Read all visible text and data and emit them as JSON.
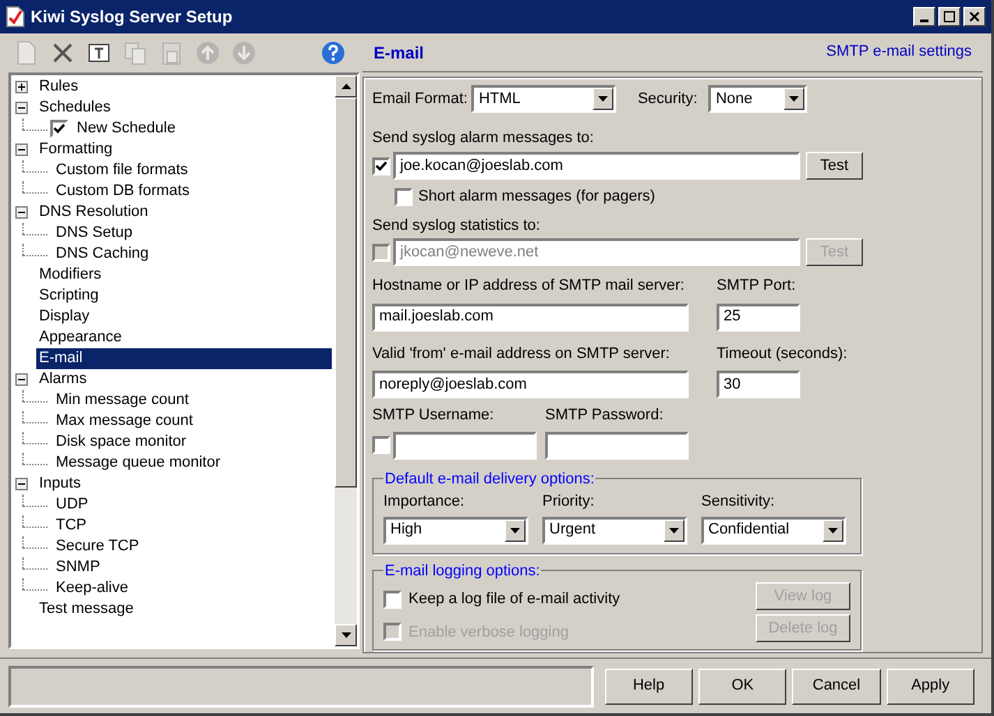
{
  "window": {
    "title": "Kiwi Syslog Server Setup"
  },
  "tree": {
    "items": [
      {
        "label": "Rules",
        "expanded": false,
        "selected": false
      },
      {
        "label": "Schedules",
        "expanded": true,
        "selected": false,
        "children": [
          {
            "label": "New Schedule",
            "checked": true,
            "selected": false
          }
        ]
      },
      {
        "label": "Formatting",
        "expanded": true,
        "selected": false,
        "children": [
          {
            "label": "Custom file formats",
            "selected": false
          },
          {
            "label": "Custom DB formats",
            "selected": false
          }
        ]
      },
      {
        "label": "DNS Resolution",
        "expanded": true,
        "selected": false,
        "children": [
          {
            "label": "DNS Setup",
            "selected": false
          },
          {
            "label": "DNS Caching",
            "selected": false
          }
        ]
      },
      {
        "label": "Modifiers",
        "selected": false
      },
      {
        "label": "Scripting",
        "selected": false
      },
      {
        "label": "Display",
        "selected": false
      },
      {
        "label": "Appearance",
        "selected": false
      },
      {
        "label": "E-mail",
        "selected": true
      },
      {
        "label": "Alarms",
        "expanded": true,
        "selected": false,
        "children": [
          {
            "label": "Min message count",
            "selected": false
          },
          {
            "label": "Max message count",
            "selected": false
          },
          {
            "label": "Disk space monitor",
            "selected": false
          },
          {
            "label": "Message queue monitor",
            "selected": false
          }
        ]
      },
      {
        "label": "Inputs",
        "expanded": true,
        "selected": false,
        "children": [
          {
            "label": "UDP",
            "selected": false
          },
          {
            "label": "TCP",
            "selected": false
          },
          {
            "label": "Secure TCP",
            "selected": false
          },
          {
            "label": "SNMP",
            "selected": false
          },
          {
            "label": "Keep-alive",
            "selected": false
          }
        ]
      },
      {
        "label": "Test message",
        "selected": false
      }
    ]
  },
  "section": {
    "title": "E-mail",
    "subtitle": "SMTP e-mail settings"
  },
  "email_format": {
    "label": "Email Format:",
    "value": "HTML"
  },
  "security": {
    "label": "Security:",
    "value": "None"
  },
  "alarm": {
    "label": "Send syslog alarm messages to:",
    "checked": true,
    "value": "joe.kocan@joeslab.com",
    "disabled": false,
    "button": "Test"
  },
  "short_alarm": {
    "label": "Short alarm messages (for pagers)",
    "checked": false
  },
  "stats": {
    "label": "Send syslog statistics to:",
    "checked": false,
    "value": "jkocan@neweve.net",
    "disabled": true,
    "button": "Test"
  },
  "smtp_host": {
    "label": "Hostname or IP address of SMTP mail server:",
    "value": "mail.joeslab.com"
  },
  "smtp_port": {
    "label": "SMTP Port:",
    "value": "25"
  },
  "from_address": {
    "label": "Valid 'from' e-mail address on SMTP server:",
    "value": "noreply@joeslab.com"
  },
  "timeout": {
    "label": "Timeout (seconds):",
    "value": "30"
  },
  "smtp_username": {
    "label": "SMTP Username:",
    "checked": false
  },
  "smtp_password": {
    "label": "SMTP Password:"
  },
  "delivery": {
    "title": "Default e-mail delivery options:",
    "fields": [
      {
        "label": "Importance:",
        "value": "High"
      },
      {
        "label": "Priority:",
        "value": "Urgent"
      },
      {
        "label": "Sensitivity:",
        "value": "Confidential"
      }
    ]
  },
  "logging": {
    "title": "E-mail logging options:",
    "options": [
      {
        "label": "Keep a log file of e-mail activity",
        "checked": false,
        "disabled": false
      },
      {
        "label": "Enable verbose logging",
        "checked": false,
        "disabled": true
      }
    ],
    "buttons": [
      {
        "label": "View log",
        "disabled": true
      },
      {
        "label": "Delete log",
        "disabled": true
      }
    ]
  },
  "buttons": [
    {
      "label": "Help"
    },
    {
      "label": "OK"
    },
    {
      "label": "Cancel"
    },
    {
      "label": "Apply"
    }
  ]
}
